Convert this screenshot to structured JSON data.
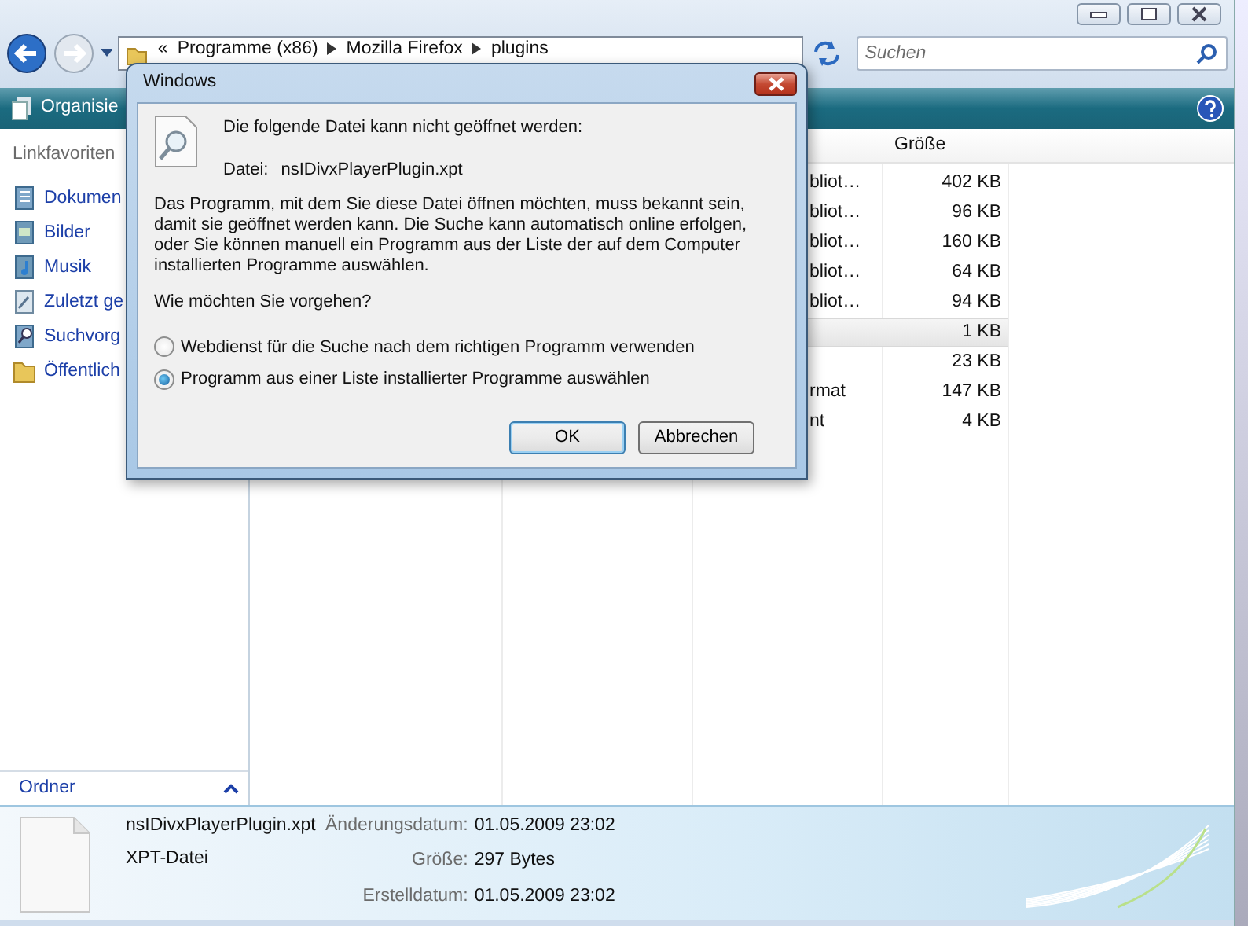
{
  "address_bar": {
    "overflow": "«",
    "breadcrumbs": [
      "Programme (x86)",
      "Mozilla Firefox",
      "plugins"
    ]
  },
  "search": {
    "placeholder": "Suchen"
  },
  "toolbar": {
    "organize": "Organisie"
  },
  "sidebar": {
    "heading": "Linkfavoriten",
    "items": [
      {
        "label": "Dokumen",
        "kind": "documents"
      },
      {
        "label": "Bilder",
        "kind": "pictures"
      },
      {
        "label": "Musik",
        "kind": "music"
      },
      {
        "label": "Zuletzt ge",
        "kind": "recent"
      },
      {
        "label": "Suchvorg",
        "kind": "searches"
      },
      {
        "label": "Öffentlich",
        "kind": "folder"
      }
    ],
    "folders": "Ordner"
  },
  "file_list": {
    "columns": [
      {
        "label": "Größe"
      }
    ],
    "rows": [
      {
        "type": "bliot…",
        "size": "402 KB",
        "selected": false
      },
      {
        "type": "bliot…",
        "size": "96 KB",
        "selected": false
      },
      {
        "type": "bliot…",
        "size": "160 KB",
        "selected": false
      },
      {
        "type": "bliot…",
        "size": "64 KB",
        "selected": false
      },
      {
        "type": "bliot…",
        "size": "94 KB",
        "selected": false
      },
      {
        "size": "1 KB",
        "selected": true
      },
      {
        "size": "23 KB",
        "selected": false
      },
      {
        "type": "rmat",
        "size": "147 KB",
        "selected": false
      },
      {
        "type": "nt",
        "size": "4 KB",
        "selected": false
      }
    ]
  },
  "details": {
    "name": "nsIDivxPlayerPlugin.xpt",
    "type": "XPT-Datei",
    "fields": [
      {
        "label": "Änderungsdatum:",
        "value": "01.05.2009 23:02"
      },
      {
        "label": "Größe:",
        "value": "297 Bytes"
      },
      {
        "label": "Erstelldatum:",
        "value": "01.05.2009 23:02"
      }
    ]
  },
  "dialog": {
    "title": "Windows",
    "heading": "Die folgende Datei kann nicht geöffnet werden:",
    "file_label": "Datei:",
    "file_name": "nsIDivxPlayerPlugin.xpt",
    "message": "Das Programm, mit dem Sie diese Datei öffnen möchten, muss bekannt sein, damit sie geöffnet werden kann. Die Suche kann automatisch online erfolgen, oder Sie können manuell ein Programm aus der Liste der auf dem Computer installierten Programme auswählen.",
    "question": "Wie möchten Sie vorgehen?",
    "options": [
      {
        "label": "Webdienst für die Suche nach dem richtigen Programm verwenden",
        "selected": false
      },
      {
        "label": "Programm aus einer Liste installierter Programme auswählen",
        "selected": true
      }
    ],
    "buttons": [
      {
        "label": "OK",
        "kind": "default"
      },
      {
        "label": "Abbrechen",
        "kind": "normal"
      }
    ]
  }
}
